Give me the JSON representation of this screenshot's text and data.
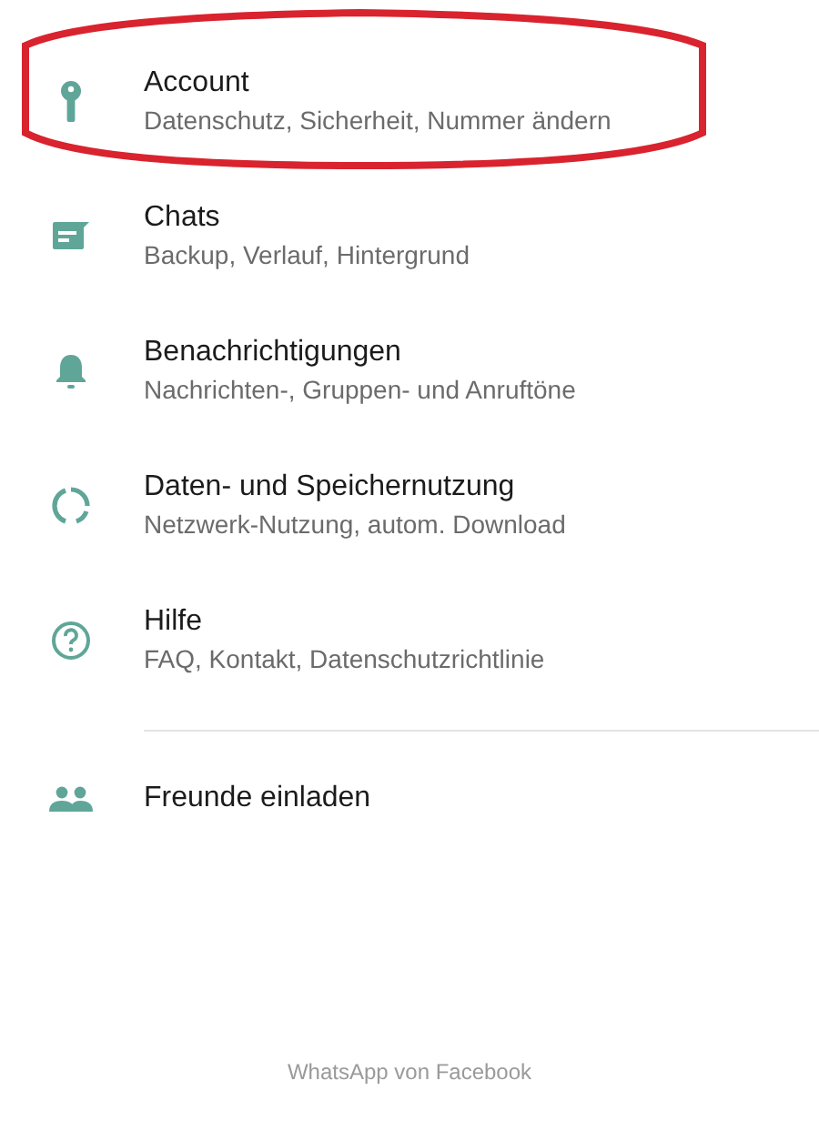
{
  "settings": [
    {
      "title": "Account",
      "subtitle": "Datenschutz, Sicherheit, Nummer ändern",
      "highlighted": true
    },
    {
      "title": "Chats",
      "subtitle": "Backup, Verlauf, Hintergrund",
      "highlighted": false
    },
    {
      "title": "Benachrichtigungen",
      "subtitle": "Nachrichten-, Gruppen- und Anruftöne",
      "highlighted": false
    },
    {
      "title": "Daten- und Speichernutzung",
      "subtitle": "Netzwerk-Nutzung, autom. Download",
      "highlighted": false
    },
    {
      "title": "Hilfe",
      "subtitle": "FAQ, Kontakt, Datenschutzrichtlinie",
      "highlighted": false
    }
  ],
  "invite": {
    "title": "Freunde einladen"
  },
  "footer": "WhatsApp von Facebook"
}
